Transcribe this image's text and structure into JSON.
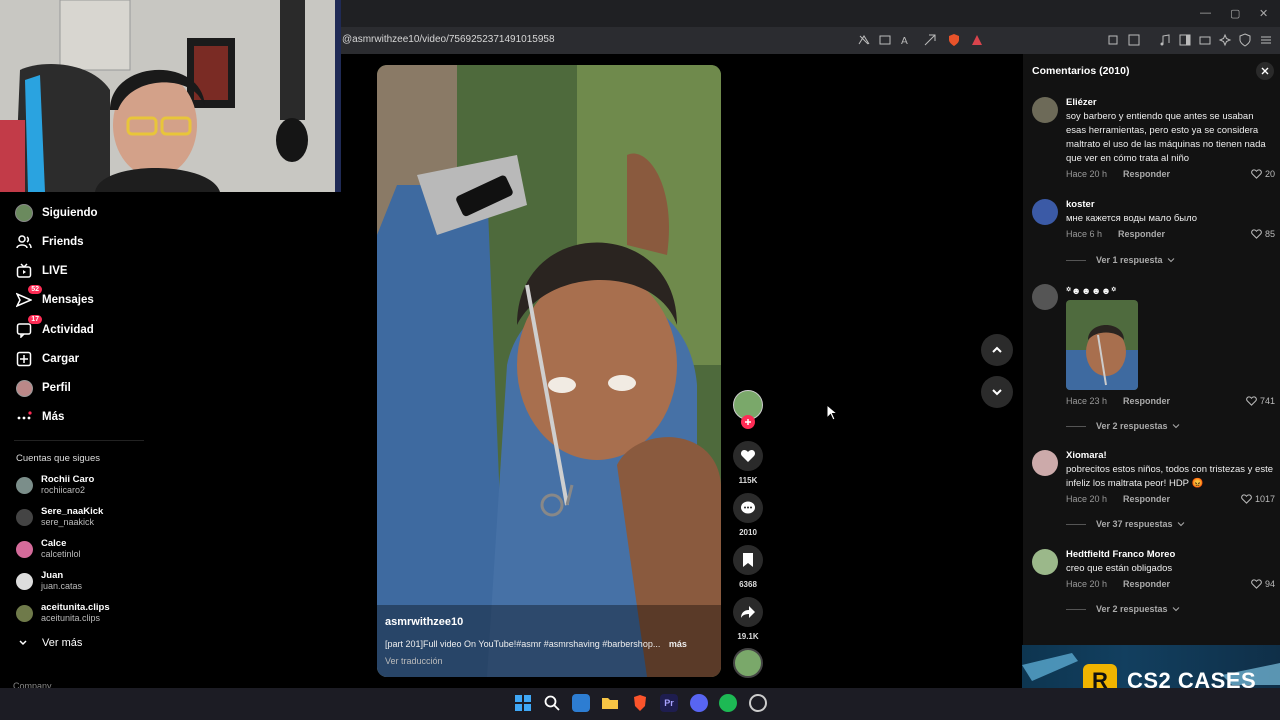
{
  "browser": {
    "url": "@asmrwithzee10/video/7569252371491015958"
  },
  "nav": {
    "items": [
      {
        "label": "Siguiendo",
        "icon": "following-avatar-icon"
      },
      {
        "label": "Friends",
        "icon": "friends-icon"
      },
      {
        "label": "LIVE",
        "icon": "live-icon"
      },
      {
        "label": "Mensajes",
        "icon": "messages-icon",
        "badge": "52"
      },
      {
        "label": "Actividad",
        "icon": "activity-icon",
        "badge": "17"
      },
      {
        "label": "Cargar",
        "icon": "upload-icon"
      },
      {
        "label": "Perfil",
        "icon": "profile-icon"
      },
      {
        "label": "Más",
        "icon": "more-icon"
      }
    ],
    "following_header": "Cuentas que sigues",
    "following": [
      {
        "name": "Rochii Caro",
        "handle": "rochiicaro2"
      },
      {
        "name": "Sere_naaKick",
        "handle": "sere_naakick"
      },
      {
        "name": "Calce",
        "handle": "calcetinlol"
      },
      {
        "name": "Juan",
        "handle": "juan.catas"
      },
      {
        "name": "aceitunita.clips",
        "handle": "aceitunita.clips"
      }
    ],
    "see_more": "Ver más",
    "company": "Company"
  },
  "video": {
    "author": "asmrwithzee10",
    "description": "[part 201]Full video On YouTube!#asmr #asmrshaving #barbershop...",
    "more": "más",
    "translate": "Ver traducción",
    "likes": "115K",
    "comments": "2010",
    "saves": "6368",
    "shares": "19.1K"
  },
  "comments": {
    "title": "Comentarios (2010)",
    "items": [
      {
        "user": "Eliézer",
        "text": "soy barbero y entiendo que antes se usaban esas herramientas, pero esto ya se considera maltrato el uso de las máquinas no tienen nada que ver en cómo trata al niño",
        "time": "Hace 20 h",
        "reply": "Responder",
        "likes": "20",
        "replies": ""
      },
      {
        "user": "koster",
        "text": "мне кажется воды мало было",
        "time": "Hace 6 h",
        "reply": "Responder",
        "likes": "85",
        "replies": "Ver 1 respuesta"
      },
      {
        "user": "꙳☻☻☻☻꙳",
        "text": "",
        "time": "Hace 23 h",
        "reply": "Responder",
        "likes": "741",
        "replies": "Ver 2 respuestas"
      },
      {
        "user": "Xiomara!",
        "text": "pobrecitos estos niños, todos con tristezas y este infeliz los maltrata peor! HDP 😡",
        "time": "Hace 20 h",
        "reply": "Responder",
        "likes": "1017",
        "replies": "Ver 37 respuestas"
      },
      {
        "user": "Hedtfieltd Franco Moreo",
        "text": "creo que están obligados",
        "time": "Hace 20 h",
        "reply": "Responder",
        "likes": "94",
        "replies": "Ver 2 respuestas"
      }
    ]
  },
  "ad": {
    "logo": "R",
    "text": "CS2 CASES"
  },
  "colors": {
    "accent": "#fe2c55",
    "panel": "#121212"
  }
}
